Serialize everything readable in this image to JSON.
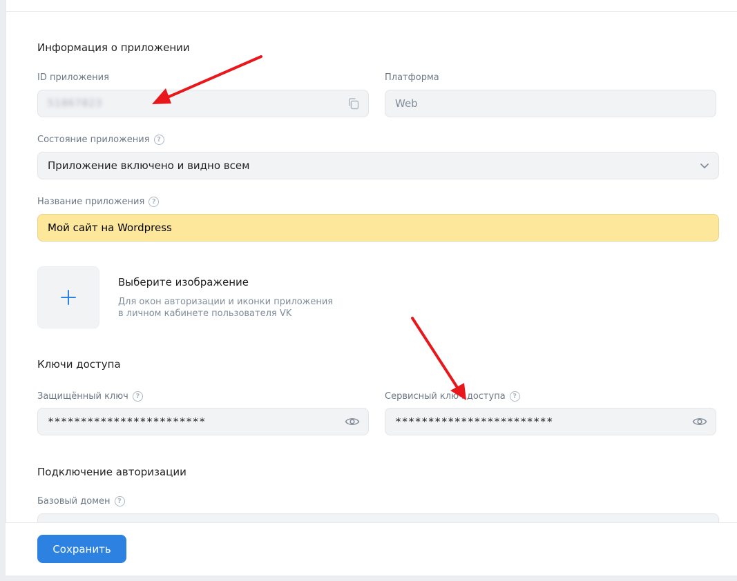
{
  "sections": {
    "app_info_title": "Информация о приложении",
    "access_keys_title": "Ключи доступа",
    "auth_title": "Подключение авторизации"
  },
  "app_id": {
    "label": "ID приложения",
    "value": "51867823"
  },
  "platform": {
    "label": "Платформа",
    "value": "Web"
  },
  "app_state": {
    "label": "Состояние приложения",
    "value": "Приложение включено и видно всем"
  },
  "app_name": {
    "label": "Название приложения",
    "value": "Мой сайт на Wordpress"
  },
  "image": {
    "title": "Выберите изображение",
    "desc_line1": "Для окон авторизации и иконки приложения",
    "desc_line2": "в личном кабинете пользователя VK"
  },
  "secure_key": {
    "label": "Защищённый ключ",
    "value": "************************"
  },
  "service_key": {
    "label": "Сервисный ключ доступа",
    "value": "************************"
  },
  "base_domain": {
    "label": "Базовый домен"
  },
  "footer": {
    "save_label": "Сохранить"
  },
  "colors": {
    "primary": "#2d81e0",
    "highlight": "#fce79a",
    "annotation_arrow": "#e8171c"
  },
  "icons": {
    "copy": "copy-icon",
    "chevron": "chevron-down-icon",
    "eye": "eye-icon",
    "help": "help-icon",
    "plus": "plus-icon"
  }
}
